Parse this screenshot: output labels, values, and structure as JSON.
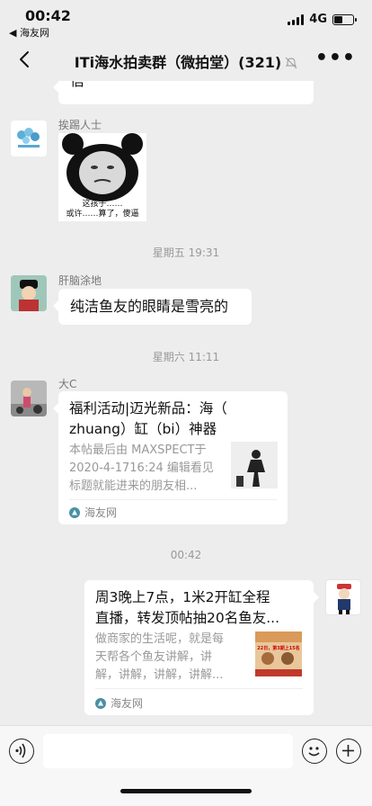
{
  "status_bar": {
    "time": "00:42",
    "back_app": "◀ 海友网",
    "network": "4G",
    "battery_level": 0.45
  },
  "nav": {
    "title": "ITi海水拍卖群（微拍堂）(321)"
  },
  "messages": {
    "partial_text": "信",
    "msg1": {
      "sender": "挨踢人士",
      "sticker_caption_line1": "这孩子……",
      "sticker_caption_line2": "或许……算了，傻逼"
    },
    "time1": "星期五 19:31",
    "msg2": {
      "sender": "肝脑涂地",
      "text": "纯洁鱼友的眼睛是雪亮的"
    },
    "time2": "星期六 11:11",
    "msg3": {
      "sender": "大C",
      "title_line1": "福利活动|迈光新品：海（",
      "title_line2": "zhuang）缸（bi）神器",
      "desc_line1": "本帖最后由 MAXSPECT于",
      "desc_line2": "2020-4-1716:24 编辑看见",
      "desc_line3": "标题就能进来的朋友相...",
      "source": "海友网"
    },
    "time3": "00:42",
    "msg4": {
      "title_line1": "周3晚上7点，1米2开缸全程",
      "title_line2": "直播，转发顶帖抽20名鱼友...",
      "desc_line1": "做商家的生活呢，就是每",
      "desc_line2": "天帮各个鱼友讲解，讲",
      "desc_line3": "解，讲解，讲解，讲解...",
      "thumb_text": "22日，第3期上15名",
      "source": "海友网"
    }
  },
  "colors": {
    "background": "#ededed",
    "bubble": "#ffffff",
    "meta_text": "#999999"
  }
}
